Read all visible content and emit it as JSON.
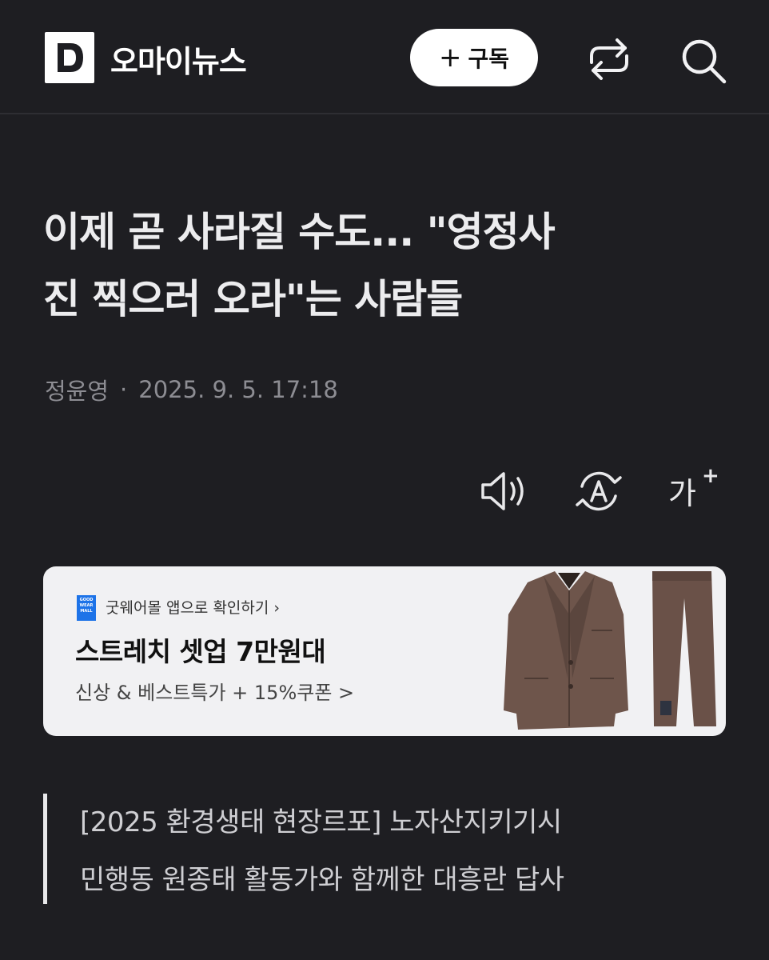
{
  "header": {
    "logo_letter": "D",
    "brand": "오마이뉴스",
    "subscribe_plus": "+",
    "subscribe_label": "구독"
  },
  "article": {
    "title_line1": "이제 곧 사라질 수도... \"영정사",
    "title_line2": "진 찍으러 오라\"는 사람들",
    "author": "정윤영",
    "separator": "·",
    "datetime": "2025. 9. 5. 17:18",
    "summary_line1": "[2025 환경생태 현장르포] 노자산지키기시",
    "summary_line2": "민행동 원종태 활동가와 함께한 대흥란 답사"
  },
  "tools": {
    "font_size_label": "가",
    "font_size_sup": "+"
  },
  "ad": {
    "badge_text": "GOOD WEAR MALL",
    "app_text": "굿웨어몰 앱으로 확인하기 ›",
    "headline": "스트레치 셋업 7만원대",
    "sub": "신상 & 베스트특가 + 15%쿠폰 >"
  },
  "colors": {
    "background": "#1e1e22",
    "ad_background": "#f1f1f3",
    "suit": "#6e554b"
  },
  "icons": [
    "logo-icon",
    "share-icon",
    "search-icon",
    "speaker-icon",
    "translate-icon"
  ]
}
